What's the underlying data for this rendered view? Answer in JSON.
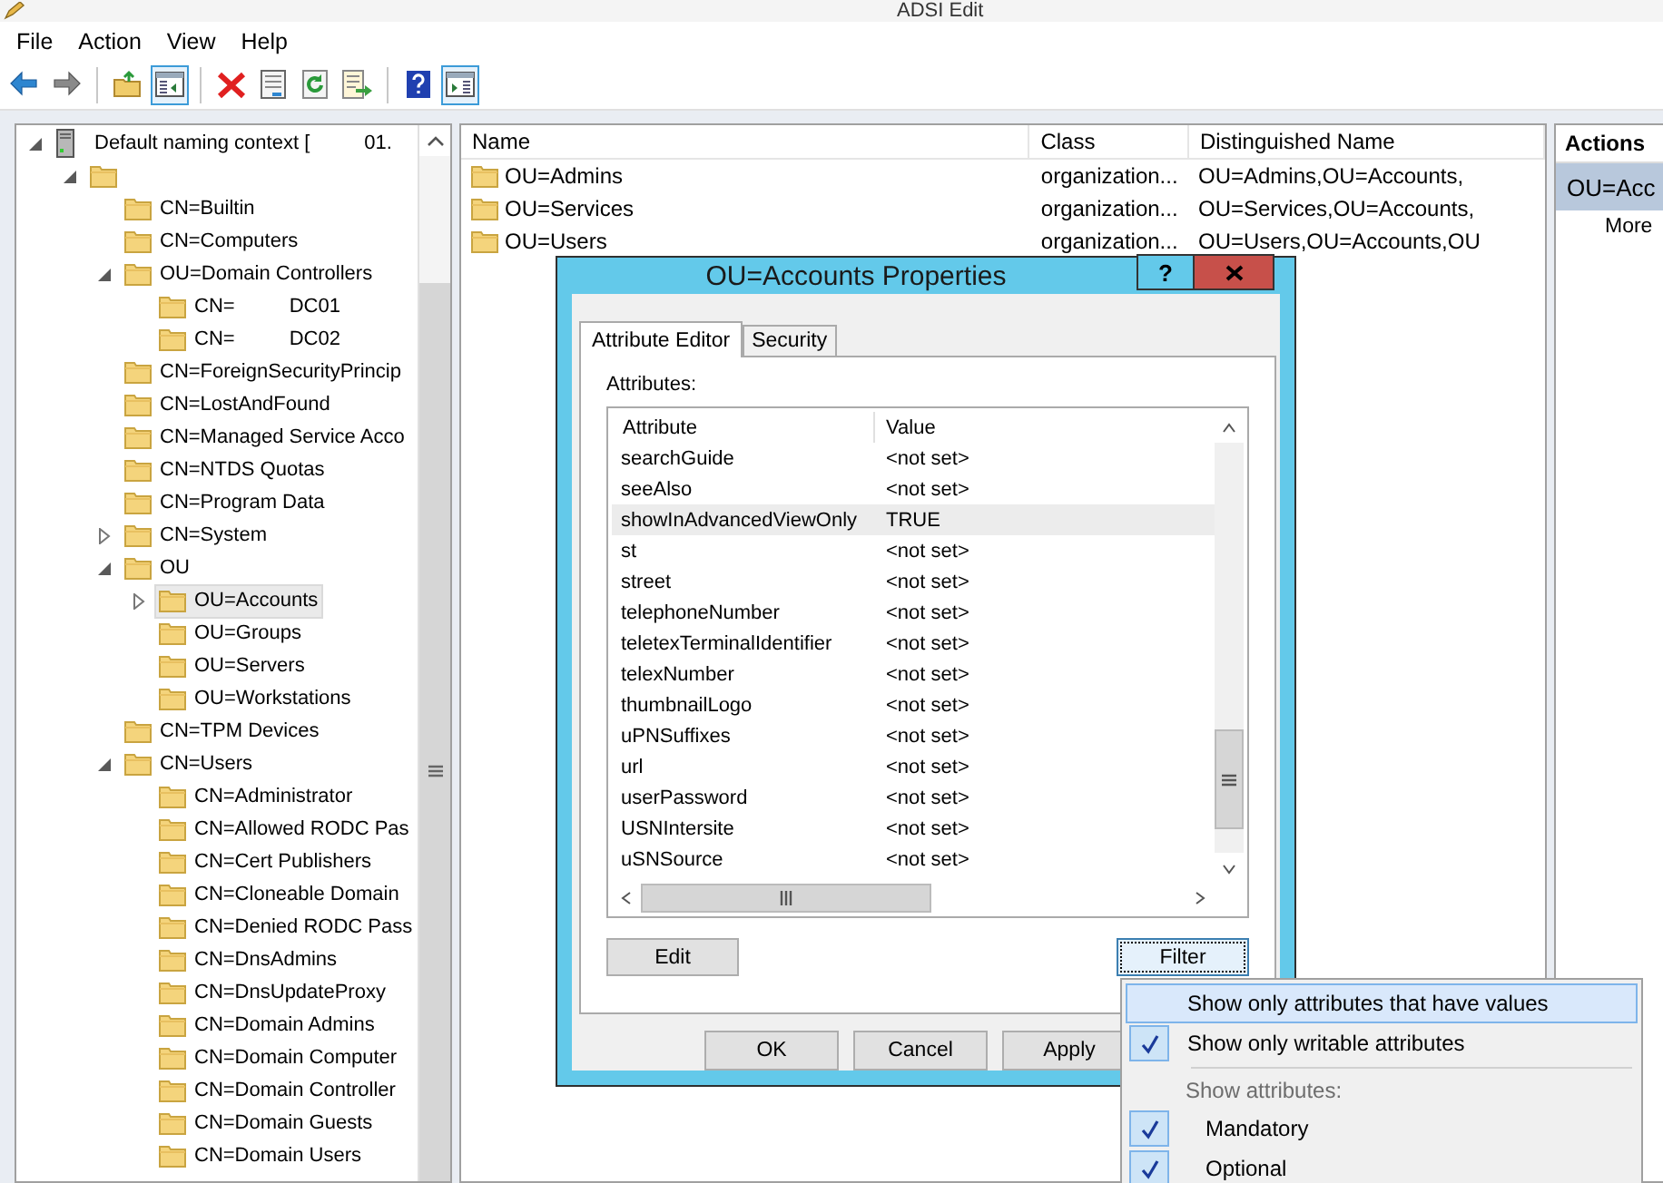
{
  "window": {
    "title": "ADSI Edit"
  },
  "menu_bar": [
    "File",
    "Action",
    "View",
    "Help"
  ],
  "toolbar": [
    [
      {
        "pressed": false
      },
      {
        "pressed": false
      }
    ],
    [
      {
        "pressed": false
      },
      {
        "pressed": true
      }
    ],
    [
      {
        "pressed": false
      },
      {
        "pressed": false
      },
      {
        "pressed": false
      },
      {
        "pressed": false
      }
    ],
    [
      {
        "pressed": false
      },
      {
        "pressed": true
      }
    ]
  ],
  "tree": [
    {
      "kind": "context",
      "label": "Default naming context [",
      "suffix": "01.",
      "expanded": true,
      "selected": false,
      "children": [
        {
          "kind": "container",
          "expanded": true,
          "selected": false,
          "children": [
            {
              "kind": "container",
              "label": "CN=Builtin",
              "selected": false
            },
            {
              "kind": "container",
              "label": "CN=Computers",
              "selected": false
            },
            {
              "kind": "container",
              "label": "OU=Domain Controllers",
              "expanded": true,
              "selected": false,
              "children": [
                {
                  "kind": "container",
                  "label": "CN=",
                  "suffix": "DC01",
                  "selected": false
                },
                {
                  "kind": "container",
                  "label": "CN=",
                  "suffix": "DC02",
                  "selected": false
                }
              ]
            },
            {
              "kind": "container",
              "label": "CN=ForeignSecurityPrincip",
              "selected": false
            },
            {
              "kind": "container",
              "label": "CN=LostAndFound",
              "selected": false
            },
            {
              "kind": "container",
              "label": "CN=Managed Service Acco",
              "selected": false
            },
            {
              "kind": "container",
              "label": "CN=NTDS Quotas",
              "selected": false
            },
            {
              "kind": "container",
              "label": "CN=Program Data",
              "selected": false
            },
            {
              "kind": "container",
              "label": "CN=System",
              "expanded": false,
              "selected": false
            },
            {
              "kind": "container",
              "label": "OU",
              "expanded": true,
              "selected": false,
              "children": [
                {
                  "kind": "container",
                  "label": "OU=Accounts",
                  "expanded": false,
                  "selected": true
                },
                {
                  "kind": "container",
                  "label": "OU=Groups",
                  "selected": false
                },
                {
                  "kind": "container",
                  "label": "OU=Servers",
                  "selected": false
                },
                {
                  "kind": "container",
                  "label": "OU=Workstations",
                  "selected": false
                }
              ]
            },
            {
              "kind": "container",
              "label": "CN=TPM Devices",
              "selected": false
            },
            {
              "kind": "container",
              "label": "CN=Users",
              "expanded": true,
              "selected": false,
              "children": [
                {
                  "kind": "container",
                  "label": "CN=Administrator",
                  "selected": false
                },
                {
                  "kind": "container",
                  "label": "CN=Allowed RODC Pas",
                  "selected": false
                },
                {
                  "kind": "container",
                  "label": "CN=Cert Publishers",
                  "selected": false
                },
                {
                  "kind": "container",
                  "label": "CN=Cloneable Domain",
                  "selected": false
                },
                {
                  "kind": "container",
                  "label": "CN=Denied RODC Pass",
                  "selected": false
                },
                {
                  "kind": "container",
                  "label": "CN=DnsAdmins",
                  "selected": false
                },
                {
                  "kind": "container",
                  "label": "CN=DnsUpdateProxy",
                  "selected": false
                },
                {
                  "kind": "container",
                  "label": "CN=Domain Admins",
                  "selected": false
                },
                {
                  "kind": "container",
                  "label": "CN=Domain Computer",
                  "selected": false
                },
                {
                  "kind": "container",
                  "label": "CN=Domain Controller",
                  "selected": false
                },
                {
                  "kind": "container",
                  "label": "CN=Domain Guests",
                  "selected": false
                },
                {
                  "kind": "container",
                  "label": "CN=Domain Users",
                  "selected": false
                }
              ]
            }
          ]
        }
      ]
    }
  ],
  "list": {
    "columns": [
      "Name",
      "Class",
      "Distinguished Name"
    ],
    "rows": [
      {
        "name": "OU=Admins",
        "class": "organization...",
        "dn": "OU=Admins,OU=Accounts,"
      },
      {
        "name": "OU=Services",
        "class": "organization...",
        "dn": "OU=Services,OU=Accounts,"
      },
      {
        "name": "OU=Users",
        "class": "organization...",
        "dn": "OU=Users,OU=Accounts,OU"
      }
    ]
  },
  "actions": {
    "title": "Actions",
    "items": [
      {
        "kind": "heading",
        "label": "OU=Acc",
        "selected": true
      },
      {
        "kind": "action",
        "label": "More",
        "selected": false
      }
    ]
  },
  "dialog": {
    "title": "OU=Accounts Properties",
    "help_button": "?",
    "tabs": [
      {
        "label": "Attribute Editor",
        "selected": true
      },
      {
        "label": "Security",
        "selected": false
      }
    ],
    "attributes_label": "Attributes:",
    "columns": [
      "Attribute",
      "Value"
    ],
    "rows": [
      {
        "attribute": "searchGuide",
        "value": "<not set>",
        "highlighted": false
      },
      {
        "attribute": "seeAlso",
        "value": "<not set>",
        "highlighted": false
      },
      {
        "attribute": "showInAdvancedViewOnly",
        "value": "TRUE",
        "highlighted": true
      },
      {
        "attribute": "st",
        "value": "<not set>",
        "highlighted": false
      },
      {
        "attribute": "street",
        "value": "<not set>",
        "highlighted": false
      },
      {
        "attribute": "telephoneNumber",
        "value": "<not set>",
        "highlighted": false
      },
      {
        "attribute": "teletexTerminalIdentifier",
        "value": "<not set>",
        "highlighted": false
      },
      {
        "attribute": "telexNumber",
        "value": "<not set>",
        "highlighted": false
      },
      {
        "attribute": "thumbnailLogo",
        "value": "<not set>",
        "highlighted": false
      },
      {
        "attribute": "uPNSuffixes",
        "value": "<not set>",
        "highlighted": false
      },
      {
        "attribute": "url",
        "value": "<not set>",
        "highlighted": false
      },
      {
        "attribute": "userPassword",
        "value": "<not set>",
        "highlighted": false
      },
      {
        "attribute": "USNIntersite",
        "value": "<not set>",
        "highlighted": false
      },
      {
        "attribute": "uSNSource",
        "value": "<not set>",
        "highlighted": false
      }
    ],
    "edit_button": {
      "label": "Edit",
      "focused": false
    },
    "filter_button": {
      "label": "Filter",
      "focused": true
    },
    "footer_buttons": [
      "OK",
      "Cancel",
      "Apply"
    ]
  },
  "filter_menu": [
    {
      "kind": "option",
      "label": "Show only attributes that have values",
      "checked": false,
      "highlighted": true
    },
    {
      "kind": "option",
      "label": "Show only writable attributes",
      "checked": true,
      "highlighted": false
    },
    {
      "kind": "separator"
    },
    {
      "kind": "header",
      "label": "Show attributes:"
    },
    {
      "kind": "suboption",
      "label": "Mandatory",
      "checked": true,
      "highlighted": false
    },
    {
      "kind": "suboption",
      "label": "Optional",
      "checked": true,
      "highlighted": false
    }
  ]
}
